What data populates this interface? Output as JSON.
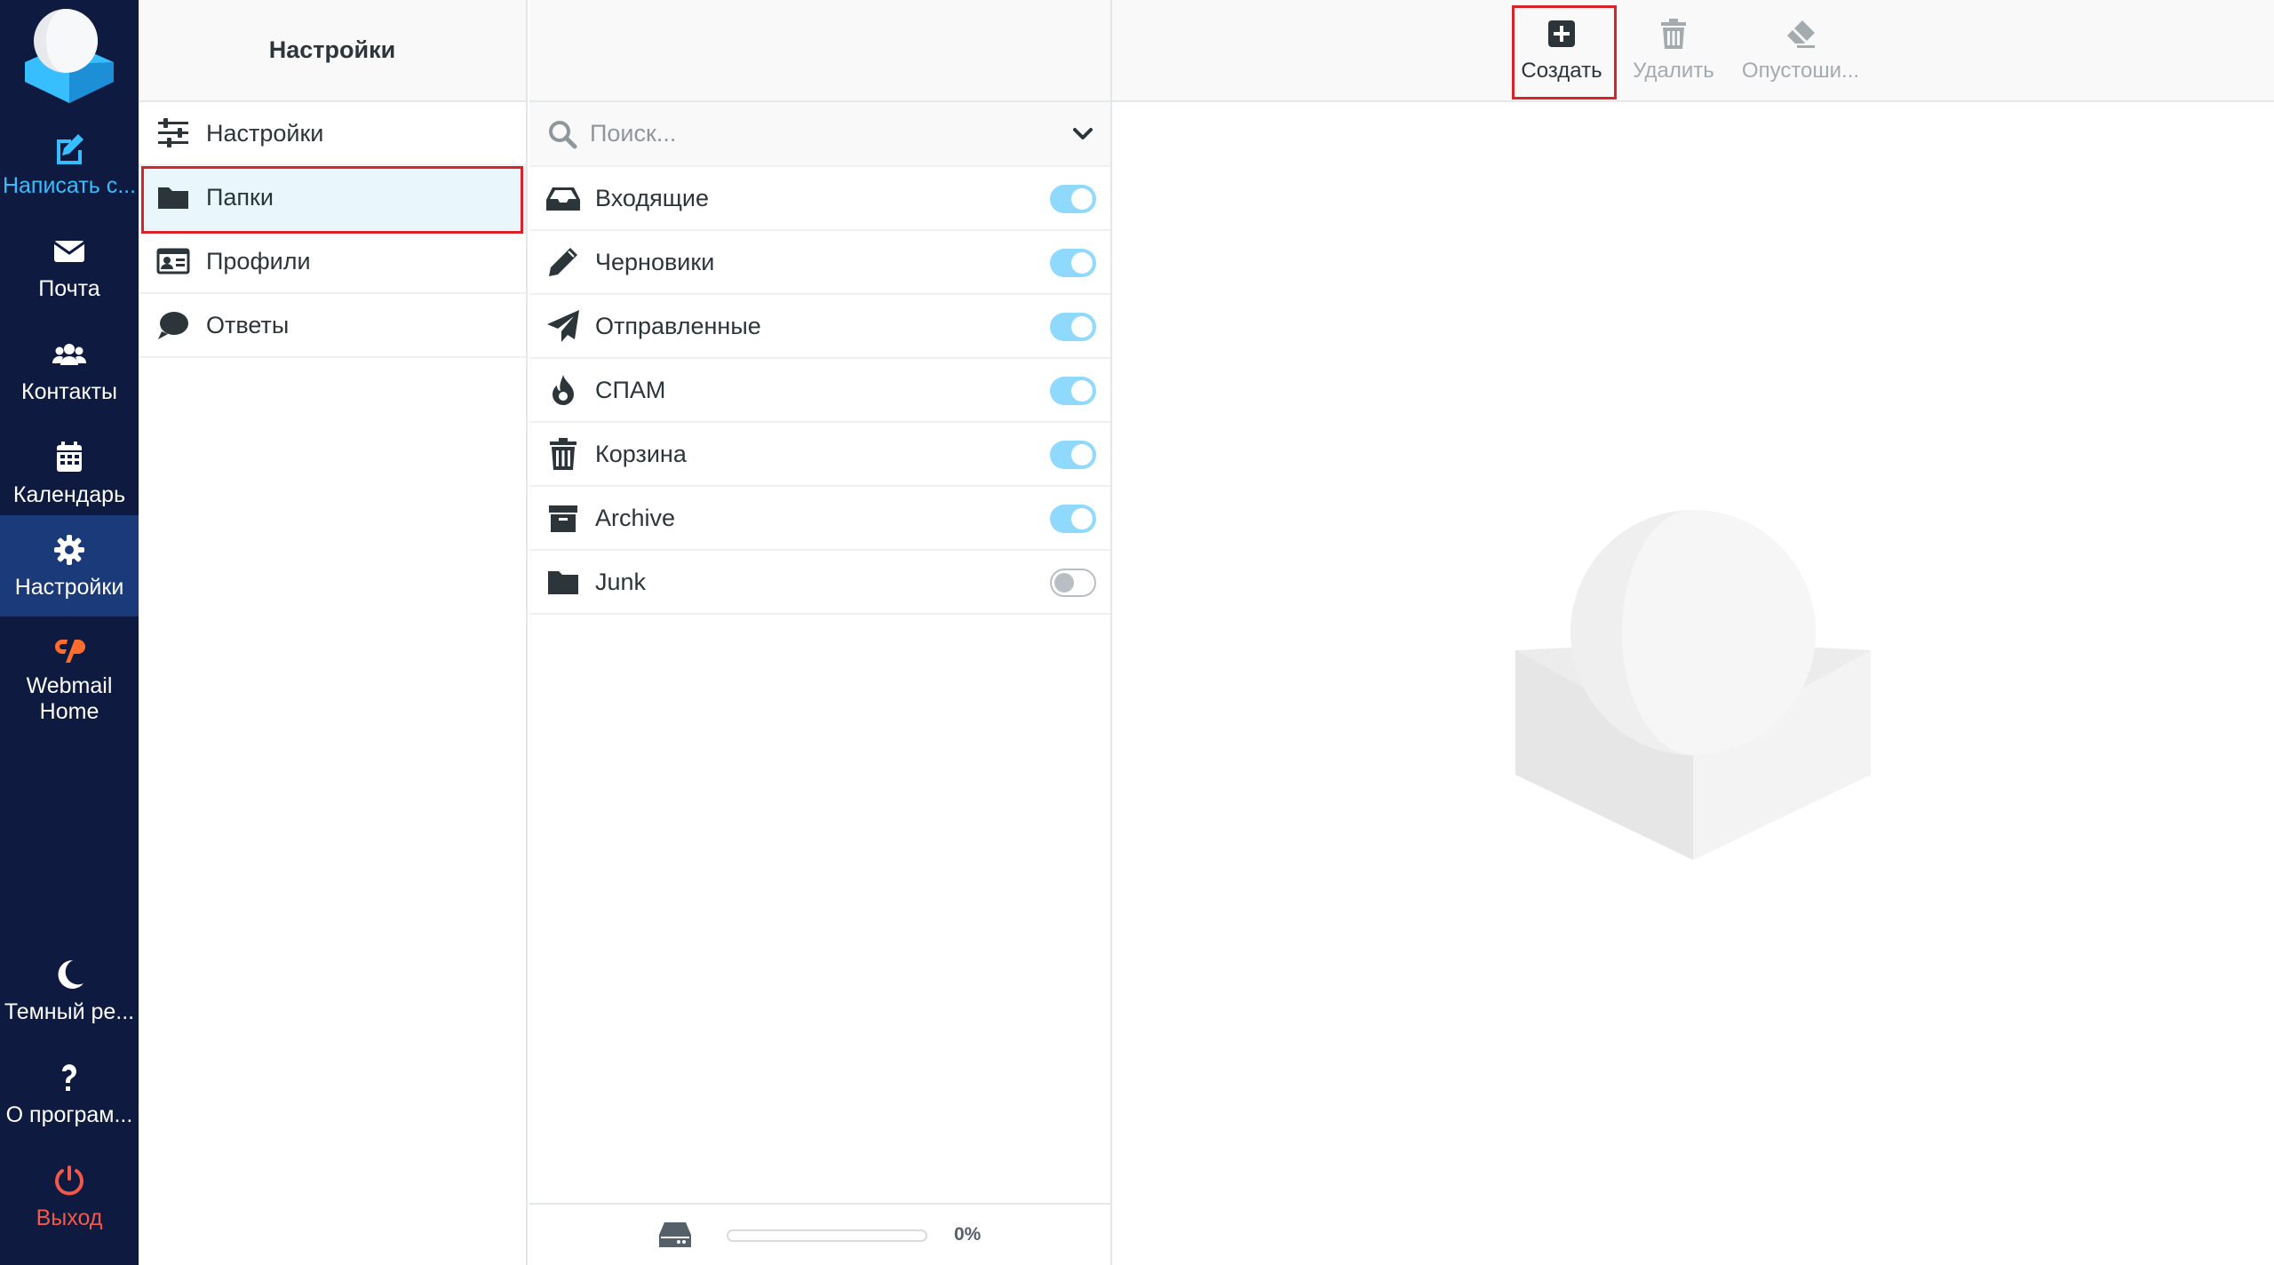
{
  "nav": {
    "logo": "roundcube-logo",
    "items": [
      {
        "label": "Написать с...",
        "icon": "compose-icon"
      },
      {
        "label": "Почта",
        "icon": "envelope-icon"
      },
      {
        "label": "Контакты",
        "icon": "users-icon"
      },
      {
        "label": "Календарь",
        "icon": "calendar-icon"
      },
      {
        "label": "Настройки",
        "icon": "gear-icon"
      },
      {
        "label": "Webmail Home",
        "icon": "cpanel-icon"
      }
    ],
    "bottom": [
      {
        "label": "Темный ре...",
        "icon": "moon-icon"
      },
      {
        "label": "О програм...",
        "icon": "question-icon"
      },
      {
        "label": "Выход",
        "icon": "power-icon"
      }
    ]
  },
  "settings": {
    "header": "Настройки",
    "items": [
      {
        "label": "Настройки",
        "icon": "sliders-icon"
      },
      {
        "label": "Папки",
        "icon": "folder-icon"
      },
      {
        "label": "Профили",
        "icon": "id-card-icon"
      },
      {
        "label": "Ответы",
        "icon": "comment-icon"
      }
    ]
  },
  "folders": {
    "search_placeholder": "Поиск...",
    "items": [
      {
        "name": "Входящие",
        "icon": "inbox-icon",
        "subscribed": true
      },
      {
        "name": "Черновики",
        "icon": "pencil-icon",
        "subscribed": true
      },
      {
        "name": "Отправленные",
        "icon": "paper-plane-icon",
        "subscribed": true
      },
      {
        "name": "СПАМ",
        "icon": "fire-icon",
        "subscribed": true
      },
      {
        "name": "Корзина",
        "icon": "trash-icon",
        "subscribed": true
      },
      {
        "name": "Archive",
        "icon": "archive-icon",
        "subscribed": true
      },
      {
        "name": "Junk",
        "icon": "folder-icon",
        "subscribed": false
      }
    ],
    "quota": {
      "percent_label": "0%",
      "fraction": 0
    }
  },
  "toolbar": {
    "create": "Создать",
    "delete": "Удалить",
    "empty": "Опустоши..."
  },
  "colors": {
    "nav_bg": "#0e1a3f",
    "accent": "#37beff",
    "toggle_on": "#8fd9ff",
    "highlight_border": "#d9232a",
    "logout": "#f3594b"
  }
}
